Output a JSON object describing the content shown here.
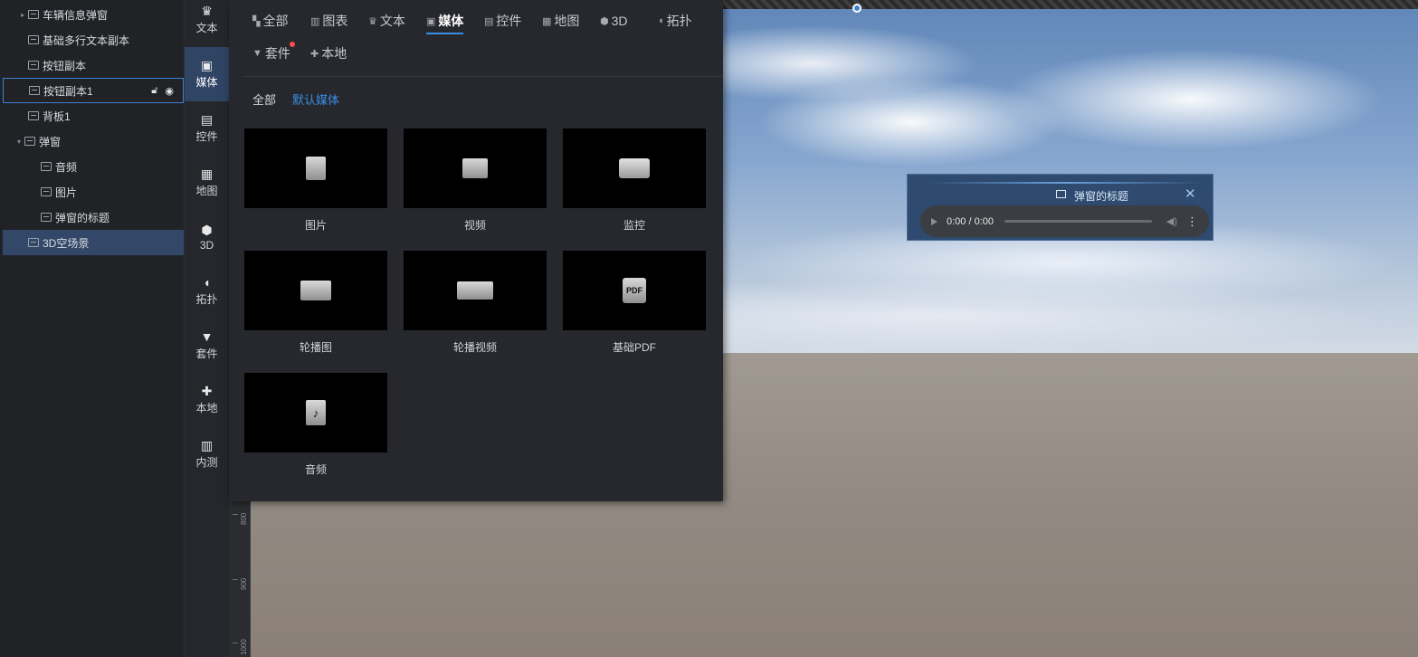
{
  "layers": [
    {
      "label": "车辆信息弹窗",
      "icon": "text-box-icon",
      "expand": "▸"
    },
    {
      "label": "基础多行文本副本",
      "icon": "text-box-icon"
    },
    {
      "label": "按钮副本",
      "icon": "button-icon"
    },
    {
      "label": "按钮副本1",
      "icon": "button-icon"
    },
    {
      "label": "背板1",
      "icon": "image-icon"
    },
    {
      "label": "弹窗",
      "icon": "text-box-icon",
      "expand": "▾"
    },
    {
      "label": "音频",
      "icon": "audio-icon"
    },
    {
      "label": "图片",
      "icon": "image-icon"
    },
    {
      "label": "弹窗的标题",
      "icon": "text-icon"
    },
    {
      "label": "3D空场景",
      "icon": "scene-3d-icon"
    }
  ],
  "categories": [
    {
      "label": "文本",
      "icon": "crown-icon",
      "glyph": "♛"
    },
    {
      "label": "媒体",
      "icon": "media-icon",
      "glyph": "▣"
    },
    {
      "label": "控件",
      "icon": "control-icon",
      "glyph": "▤"
    },
    {
      "label": "地图",
      "icon": "map-icon",
      "glyph": "▦"
    },
    {
      "label": "3D",
      "icon": "cube-icon",
      "glyph": "⬢"
    },
    {
      "label": "拓扑",
      "icon": "topology-icon",
      "glyph": "◖"
    },
    {
      "label": "套件",
      "icon": "shirt-icon",
      "glyph": "▼"
    },
    {
      "label": "本地",
      "icon": "puzzle-icon",
      "glyph": "✚"
    },
    {
      "label": "内测",
      "icon": "bars-icon",
      "glyph": "▥"
    }
  ],
  "tabs": [
    {
      "label": "全部",
      "glyph": "▚"
    },
    {
      "label": "图表",
      "glyph": "▥"
    },
    {
      "label": "文本",
      "glyph": "♛"
    },
    {
      "label": "媒体",
      "glyph": "▣"
    },
    {
      "label": "控件",
      "glyph": "▤"
    },
    {
      "label": "地图",
      "glyph": "▦"
    },
    {
      "label": "3D",
      "glyph": "⬢"
    },
    {
      "label": "拓扑",
      "glyph": "◖"
    },
    {
      "label": "套件",
      "glyph": "▼"
    },
    {
      "label": "本地",
      "glyph": "✚"
    }
  ],
  "subtabs": [
    "全部",
    "默认媒体"
  ],
  "media_items": [
    {
      "label": "图片",
      "icon": "image-file-icon"
    },
    {
      "label": "视频",
      "icon": "video-icon"
    },
    {
      "label": "监控",
      "icon": "camera-icon"
    },
    {
      "label": "轮播图",
      "icon": "carousel-icon"
    },
    {
      "label": "轮播视频",
      "icon": "carousel-video-icon"
    },
    {
      "label": "基础PDF",
      "icon": "pdf-icon",
      "badge": "PDF"
    },
    {
      "label": "音频",
      "icon": "audio-file-icon"
    }
  ],
  "popup": {
    "title": "弹窗的标题",
    "close": "✕",
    "audio_time": "0:00 / 0:00"
  },
  "ruler": {
    "labels": [
      "800",
      "900",
      "1000"
    ]
  },
  "colors": {
    "accent": "#3a8ee6",
    "selected_row": "#334868",
    "notify_dot": "#ff4d4f"
  }
}
